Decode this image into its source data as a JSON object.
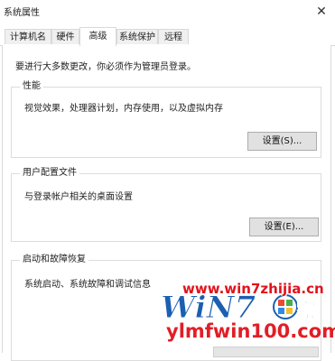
{
  "window": {
    "title": "系统属性",
    "close_glyph": "✕"
  },
  "tabs": [
    {
      "label": "计算机名",
      "active": false
    },
    {
      "label": "硬件",
      "active": false
    },
    {
      "label": "高级",
      "active": true
    },
    {
      "label": "系统保护",
      "active": false
    },
    {
      "label": "远程",
      "active": false
    }
  ],
  "intro": "要进行大多数更改，你必须作为管理员登录。",
  "groups": {
    "performance": {
      "title": "性能",
      "description": "视觉效果，处理器计划，内存使用，以及虚拟内存",
      "button": "设置(S)..."
    },
    "user_profiles": {
      "title": "用户配置文件",
      "description": "与登录帐户相关的桌面设置",
      "button": "设置(E)..."
    },
    "startup_recovery": {
      "title": "启动和故障恢复",
      "description": "系统启动、系统故障和调试信息"
    }
  },
  "watermark": {
    "site": "www.win7zhijia.cn",
    "logo_text": "Win7家",
    "bottom": "ylmfwin100.com"
  },
  "icons": {
    "close": "close-icon",
    "windows_logo": "windows-logo-icon"
  },
  "colors": {
    "watermark_red": "#e0131b",
    "logo_blue": "#1b5fb0"
  }
}
